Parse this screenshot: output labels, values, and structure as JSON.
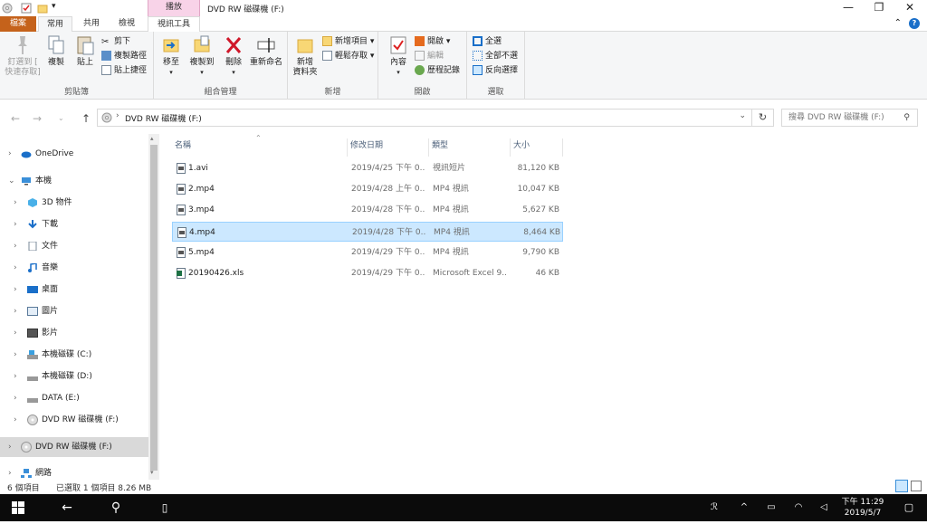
{
  "window": {
    "title": "DVD RW 磁碟機 (F:)",
    "context_tab_header": "播放",
    "minimize": "—",
    "maximize": "❐",
    "close": "✕"
  },
  "tabs": {
    "file": "檔案",
    "home": "常用",
    "share": "共用",
    "view": "檢視",
    "video_tools": "視訊工具"
  },
  "ribbon": {
    "clipboard": {
      "label": "剪貼簿",
      "pin_line1": "釘選到 [",
      "pin_line2": "快速存取]",
      "copy": "複製",
      "paste": "貼上",
      "cut": "剪下",
      "copy_path": "複製路徑",
      "paste_shortcut": "貼上捷徑"
    },
    "organize": {
      "label": "組合管理",
      "move_to": "移至",
      "copy_to": "複製到",
      "delete": "刪除",
      "rename": "重新命名"
    },
    "new": {
      "label": "新增",
      "new_folder_line1": "新增",
      "new_folder_line2": "資料夾",
      "new_item": "新增項目 ▾",
      "easy_access": "輕鬆存取 ▾"
    },
    "open": {
      "label": "開啟",
      "properties": "內容",
      "open": "開啟 ▾",
      "edit": "編輯",
      "history": "歷程記錄"
    },
    "select": {
      "label": "選取",
      "select_all": "全選",
      "select_none": "全部不選",
      "invert": "反向選擇"
    }
  },
  "address": {
    "path": "DVD RW 磁碟機 (F:)",
    "search_placeholder": "搜尋 DVD RW 磁碟機 (F:)"
  },
  "sidebar": {
    "items": [
      {
        "label": "OneDrive"
      },
      {
        "label": "本機"
      },
      {
        "label": "3D 物件"
      },
      {
        "label": "下載"
      },
      {
        "label": "文件"
      },
      {
        "label": "音樂"
      },
      {
        "label": "桌面"
      },
      {
        "label": "圖片"
      },
      {
        "label": "影片"
      },
      {
        "label": "本機磁碟 (C:)"
      },
      {
        "label": "本機磁碟 (D:)"
      },
      {
        "label": "DATA (E:)"
      },
      {
        "label": "DVD RW 磁碟機 (F:)"
      },
      {
        "label": "DVD RW 磁碟機 (F:)"
      },
      {
        "label": "網路"
      }
    ]
  },
  "columns": {
    "name": "名稱",
    "date": "修改日期",
    "type": "類型",
    "size": "大小"
  },
  "files": [
    {
      "name": "1.avi",
      "date": "2019/4/25 下午 0...",
      "type": "視訊短片",
      "size": "81,120 KB"
    },
    {
      "name": "2.mp4",
      "date": "2019/4/28 上午 0...",
      "type": "MP4 視訊",
      "size": "10,047 KB"
    },
    {
      "name": "3.mp4",
      "date": "2019/4/28 下午 0...",
      "type": "MP4 視訊",
      "size": "5,627 KB"
    },
    {
      "name": "4.mp4",
      "date": "2019/4/28 下午 0...",
      "type": "MP4 視訊",
      "size": "8,464 KB"
    },
    {
      "name": "5.mp4",
      "date": "2019/4/29 下午 0...",
      "type": "MP4 視訊",
      "size": "9,790 KB"
    },
    {
      "name": "20190426.xls",
      "date": "2019/4/29 下午 0...",
      "type": "Microsoft Excel 9...",
      "size": "46 KB"
    }
  ],
  "status": {
    "count": "6 個項目",
    "selected": "已選取 1 個項目  8.26 MB"
  },
  "taskbar": {
    "time": "下午 11:29",
    "date": "2019/5/7"
  },
  "colors": {
    "file_tab": "#c5621b",
    "selection": "#cce8ff",
    "context_tab": "#f8d3e8",
    "taskbar": "#0b0b0b"
  }
}
